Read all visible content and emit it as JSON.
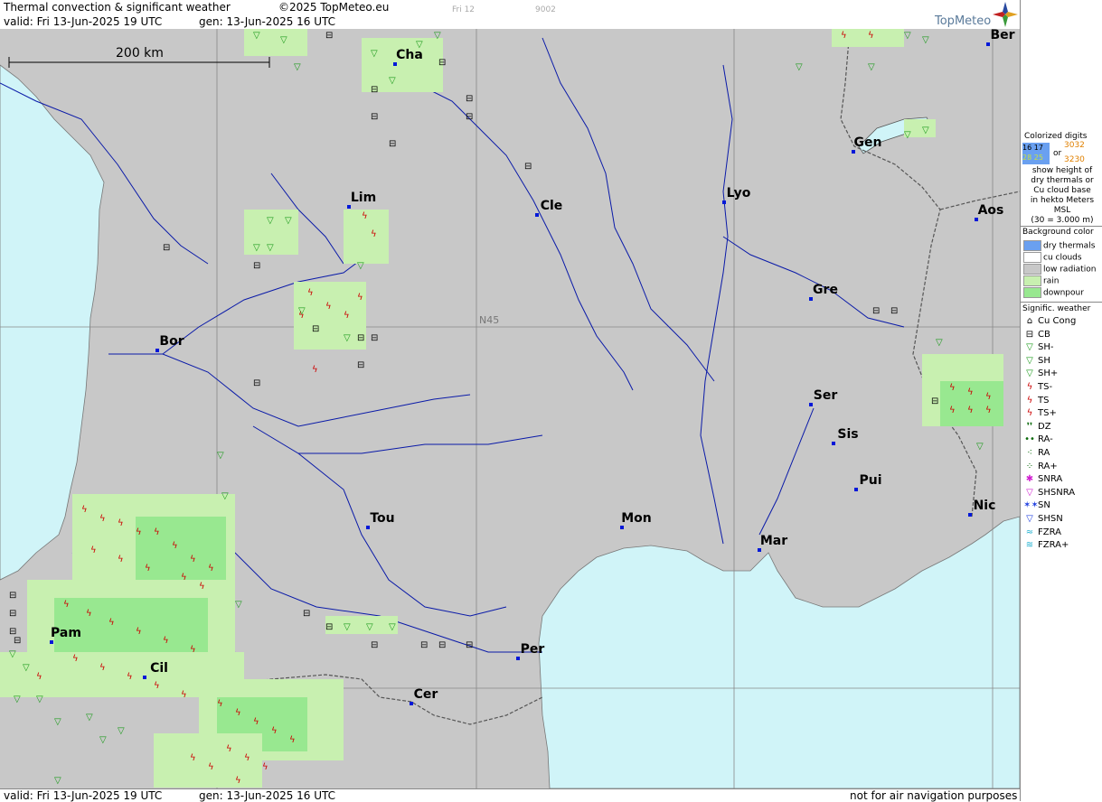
{
  "header": {
    "title": "Thermal convection & significant weather",
    "copyright": "©2025 TopMeteo.eu",
    "valid": "valid:  Fri  13-Jun-2025  19 UTC",
    "gen": "gen: 13-Jun-2025 16 UTC",
    "code_day": "Fri 12",
    "code_num": "9002",
    "brand": "TopMeteo"
  },
  "footer": {
    "valid": "valid:  Fri  13-Jun-2025  19 UTC",
    "gen": "gen: 13-Jun-2025 16 UTC",
    "disclaimer": "not for air navigation purposes"
  },
  "map": {
    "scale_label": "200 km",
    "grid_label": "N45",
    "colors": {
      "land": "#c8c8c8",
      "sea": "#d0f4f8",
      "rain": "#c8f0b0",
      "downpour": "#98e890",
      "border": "#555555",
      "river": "#0a1aa8",
      "city": "#0018d8",
      "ts": "#cc0000",
      "sh": "#1a9a1a"
    },
    "cities": [
      {
        "name": "Cha"
      },
      {
        "name": "Ber"
      },
      {
        "name": "Gen"
      },
      {
        "name": "Lim"
      },
      {
        "name": "Lyo"
      },
      {
        "name": "Cle"
      },
      {
        "name": "Aos"
      },
      {
        "name": "Gre"
      },
      {
        "name": "Bor"
      },
      {
        "name": "Ser"
      },
      {
        "name": "Sis"
      },
      {
        "name": "Pui"
      },
      {
        "name": "Tou"
      },
      {
        "name": "Mon"
      },
      {
        "name": "Nic"
      },
      {
        "name": "Mar"
      },
      {
        "name": "Pam"
      },
      {
        "name": "Per"
      },
      {
        "name": "Cil"
      },
      {
        "name": "Cer"
      }
    ]
  },
  "legend": {
    "digits_title": "Colorized digits",
    "digits_or": "or",
    "digits_sample_a": "16 17",
    "digits_sample_b": "28 25",
    "digits_sample_c": "3032",
    "digits_sample_d": "3230",
    "digits_text": [
      "show height of",
      "dry thermals or",
      "Cu cloud base",
      "in hekto Meters",
      "MSL",
      "(30 = 3.000 m)"
    ],
    "bg_title": "Background color",
    "bg_items": [
      {
        "label": "dry thermals",
        "color": "#6aa0f0"
      },
      {
        "label": "cu clouds",
        "color": "#ffffff"
      },
      {
        "label": "low radiation",
        "color": "#c8c8c8"
      },
      {
        "label": "rain",
        "color": "#c8f0b0"
      },
      {
        "label": "downpour",
        "color": "#98e890"
      }
    ],
    "wx_title": "Signific. weather",
    "wx_items": [
      {
        "label": "Cu Cong",
        "symbol": "⌂",
        "color": "#000000"
      },
      {
        "label": "CB",
        "symbol": "⊟",
        "color": "#000000"
      },
      {
        "label": "SH-",
        "symbol": "▽",
        "color": "#1a9a1a"
      },
      {
        "label": "SH",
        "symbol": "▽",
        "color": "#1a9a1a"
      },
      {
        "label": "SH+",
        "symbol": "▽",
        "color": "#1a9a1a"
      },
      {
        "label": "TS-",
        "symbol": "ϟ",
        "color": "#cc0000"
      },
      {
        "label": "TS",
        "symbol": "ϟ",
        "color": "#cc0000"
      },
      {
        "label": "TS+",
        "symbol": "ϟ",
        "color": "#cc0000"
      },
      {
        "label": "DZ",
        "symbol": "❜❜",
        "color": "#0a6a0a"
      },
      {
        "label": "RA-",
        "symbol": "••",
        "color": "#0a6a0a"
      },
      {
        "label": "RA",
        "symbol": "⁖",
        "color": "#0a6a0a"
      },
      {
        "label": "RA+",
        "symbol": "⁘",
        "color": "#0a6a0a"
      },
      {
        "label": "SNRA",
        "symbol": "✱",
        "color": "#d020d0"
      },
      {
        "label": "SHSNRA",
        "symbol": "▽",
        "color": "#d020d0"
      },
      {
        "label": "SN",
        "symbol": "✶✶",
        "color": "#2040e0"
      },
      {
        "label": "SHSN",
        "symbol": "▽",
        "color": "#2040e0"
      },
      {
        "label": "FZRA",
        "symbol": "≈",
        "color": "#20b0d0"
      },
      {
        "label": "FZRA+",
        "symbol": "≋",
        "color": "#20b0d0"
      }
    ]
  }
}
